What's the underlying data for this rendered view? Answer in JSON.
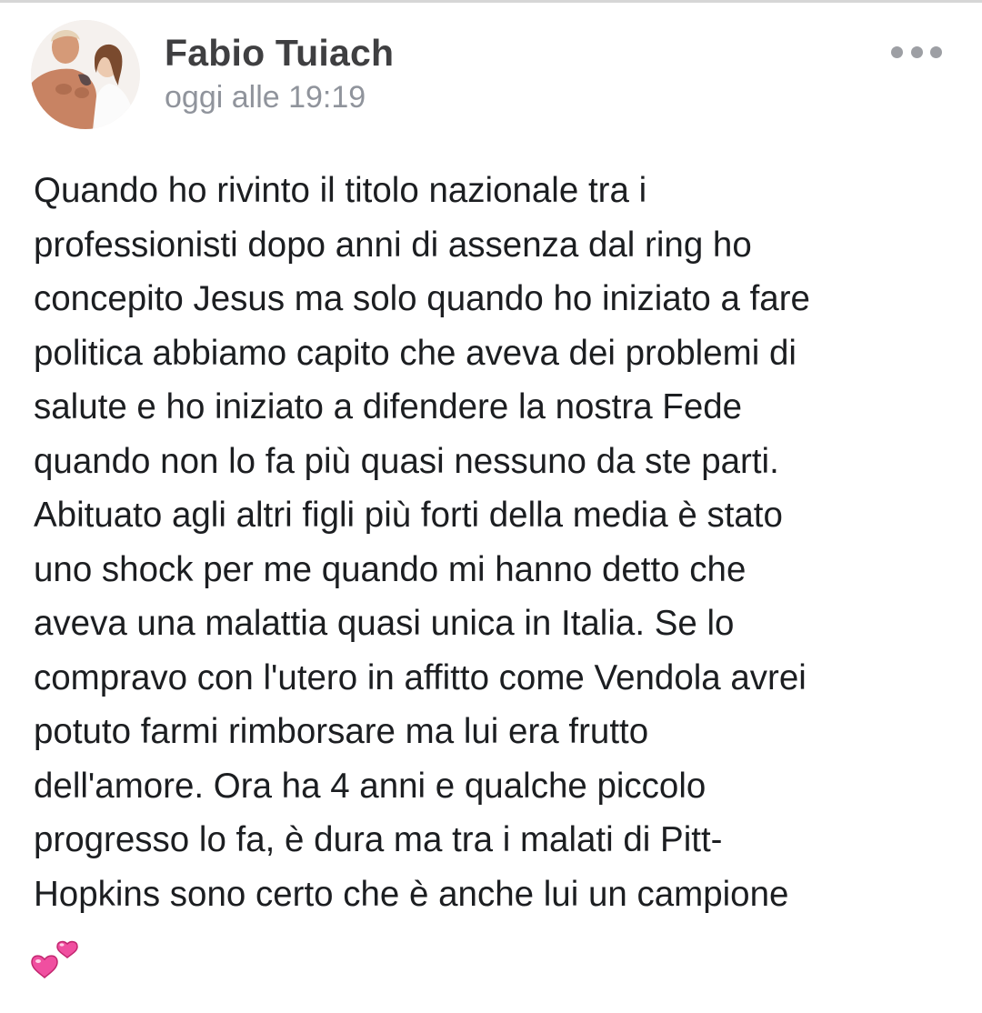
{
  "post": {
    "author": "Fabio Tuiach",
    "timestamp": "oggi alle 19:19",
    "more_icon": "more-dots-icon",
    "body_lines": [
      "Quando ho rivinto il titolo nazionale tra i",
      "professionisti dopo anni di assenza dal ring ho",
      "concepito Jesus ma solo quando ho iniziato a fare",
      "politica abbiamo capito che aveva dei problemi di",
      "salute e ho iniziato a difendere la nostra Fede",
      "quando non lo fa più quasi nessuno da ste parti.",
      "Abituato agli altri figli più forti della media è stato",
      "uno shock per me quando mi hanno detto che",
      "aveva una malattia quasi unica in Italia. Se lo",
      "compravo con l'utero in affitto come Vendola avrei",
      "potuto farmi rimborsare ma lui era frutto",
      "dell'amore. Ora ha 4 anni e qualche piccolo",
      "progresso lo fa, è dura ma tra i malati di Pitt-",
      "Hopkins sono certo che è anche lui un campione"
    ],
    "trailing_emoji": "two-hearts-emoji"
  },
  "colors": {
    "author": "#3f3f41",
    "timestamp": "#90949c",
    "text": "#1c1e21",
    "heart": "#f04fa0"
  }
}
